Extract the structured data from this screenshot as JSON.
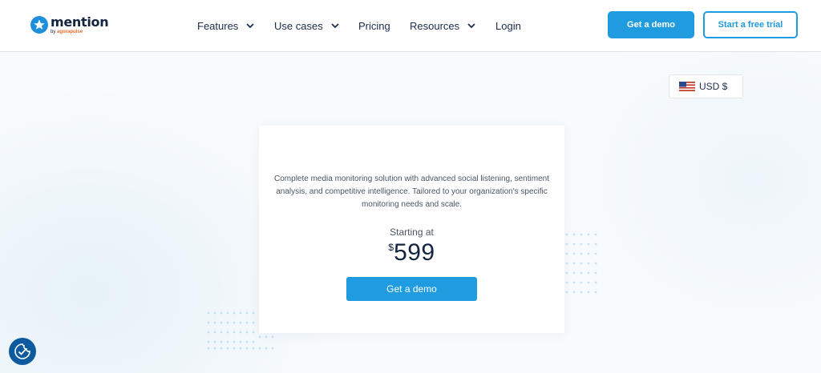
{
  "brand": {
    "name": "mention",
    "byline_prefix": "by ",
    "byline_company": "agorapulse"
  },
  "nav": {
    "items": [
      {
        "label": "Features",
        "dropdown": true
      },
      {
        "label": "Use cases",
        "dropdown": true
      },
      {
        "label": "Pricing",
        "dropdown": false
      },
      {
        "label": "Resources",
        "dropdown": true
      },
      {
        "label": "Login",
        "dropdown": false
      }
    ]
  },
  "header_buttons": {
    "demo_label": "Get a demo",
    "trial_label": "Start a free trial"
  },
  "currency": {
    "selected": "USD $",
    "flag_icon": "us-flag-icon"
  },
  "card": {
    "description": "Complete media monitoring solution with advanced social listening, sentiment analysis, and competitive intelligence. Tailored to your organization's specific monitoring needs and scale.",
    "starting_label": "Starting at",
    "currency_symbol": "$",
    "price": "599",
    "cta_label": "Get a demo"
  },
  "cookie_widget": {
    "icon": "cookie-consent-icon"
  },
  "colors": {
    "accent": "#1f9be0",
    "dark_text": "#14233f",
    "cookie_bg": "#0d5a9e",
    "brand_orange": "#ee6b2e"
  }
}
